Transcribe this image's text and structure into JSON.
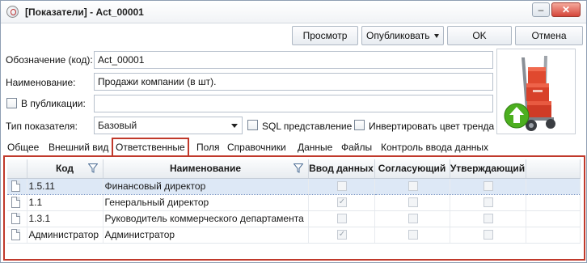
{
  "window": {
    "title": "[Показатели] - Act_00001",
    "minimize_glyph": "–",
    "maximize_glyph": "▫",
    "close_glyph": "✕"
  },
  "toolbar": {
    "preview_label": "Просмотр",
    "publish_label": "Опубликовать",
    "ok_label": "OK",
    "cancel_label": "Отмена"
  },
  "form": {
    "code_label": "Обозначение (код):",
    "code_value": "Act_00001",
    "name_label": "Наименование:",
    "name_value": "Продажи компании (в шт).",
    "publication_label": "В публикации:",
    "publication_value": "",
    "indicator_type_label": "Тип показателя:",
    "indicator_type_value": "Базовый",
    "sql_view_label": "SQL представление",
    "invert_color_label": "Инвертировать цвет тренда"
  },
  "tabs": [
    {
      "label": "Общее"
    },
    {
      "label": "Внешний вид"
    },
    {
      "label": "Ответственные",
      "active": true
    },
    {
      "label": "Поля"
    },
    {
      "label": "Справочники"
    },
    {
      "label": "Данные"
    },
    {
      "label": "Файлы"
    },
    {
      "label": "Контроль ввода данных"
    }
  ],
  "grid": {
    "columns": [
      "Код",
      "Наименование",
      "Ввод данных",
      "Согласующий",
      "Утверждающий"
    ],
    "rows": [
      {
        "code": "1.5.11",
        "name": "Финансовый директор",
        "data_entry": false,
        "approver": false,
        "confirmer": false,
        "selected": true
      },
      {
        "code": "1.1",
        "name": "Генеральный директор",
        "data_entry": true,
        "approver": false,
        "confirmer": false
      },
      {
        "code": "1.3.1",
        "name": "Руководитель коммерческого департамента",
        "data_entry": false,
        "approver": false,
        "confirmer": false
      },
      {
        "code": "Администратор",
        "name": "Администратор",
        "data_entry": true,
        "approver": false,
        "confirmer": false
      }
    ]
  },
  "icons": {
    "app": "app-icon",
    "dropdown": "chevron-down-icon",
    "filter": "filter-icon",
    "row": "document-icon",
    "picture": "hand-truck-with-boxes-and-upload-arrow-icon"
  },
  "colors": {
    "highlight": "#c0392b",
    "selected_row": "#dde8f6",
    "upload_arrow": "#4caf1f"
  }
}
